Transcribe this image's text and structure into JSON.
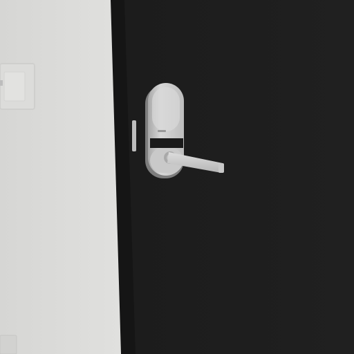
{
  "scene": {
    "description_free": true,
    "colors": {
      "wall": "#d9d9d7",
      "wall_shadow": "#c9c9c7",
      "door": "#1e1e1e",
      "door_edge": "#111111",
      "door_frame": "#151515",
      "lock_plate": "#cfcfcf",
      "lock_plate_shadow": "#9a9a9a",
      "lever": "#d3d3d3",
      "keypad_band": "#1a1a1a",
      "switch_plate": "#dcdcda",
      "latch_strike": "#bdbdbd"
    },
    "icons": {
      "lock": "smart-lock-icon",
      "switch": "light-switch-icon"
    }
  }
}
